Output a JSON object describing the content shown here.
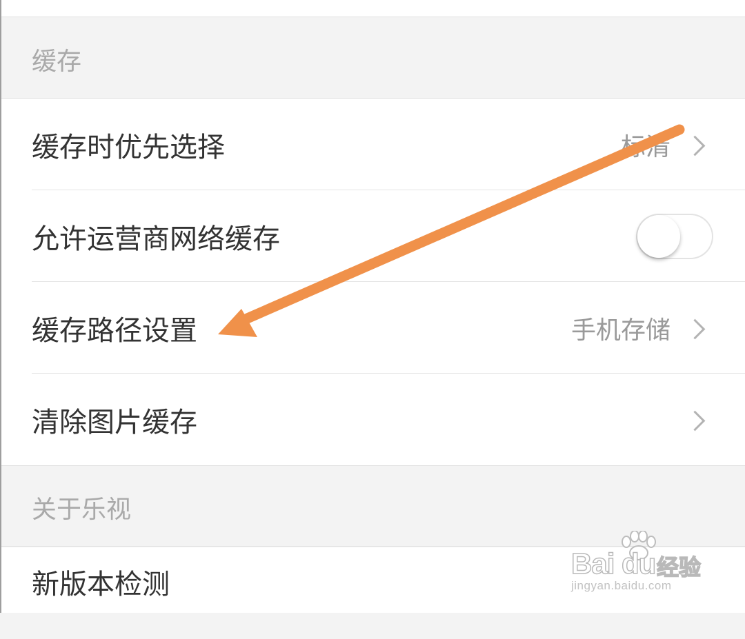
{
  "sections": [
    {
      "title": "缓存",
      "items": [
        {
          "label": "缓存时优先选择",
          "value": "标清",
          "control": "chevron"
        },
        {
          "label": "允许运营商网络缓存",
          "value": "",
          "control": "toggle",
          "toggle_on": false
        },
        {
          "label": "缓存路径设置",
          "value": "手机存储",
          "control": "chevron"
        },
        {
          "label": "清除图片缓存",
          "value": "",
          "control": "chevron"
        }
      ]
    },
    {
      "title": "关于乐视",
      "items": [
        {
          "label": "新版本检测",
          "value": "",
          "control": "none"
        }
      ]
    }
  ],
  "annotation": {
    "color": "#f0914a",
    "points_to": "缓存路径设置"
  },
  "watermark": {
    "brand": "Bai du",
    "sub": "经验",
    "url": "jingyan.baidu.com"
  },
  "icons": [
    "chevron-right-icon",
    "toggle-switch",
    "paw-icon"
  ]
}
